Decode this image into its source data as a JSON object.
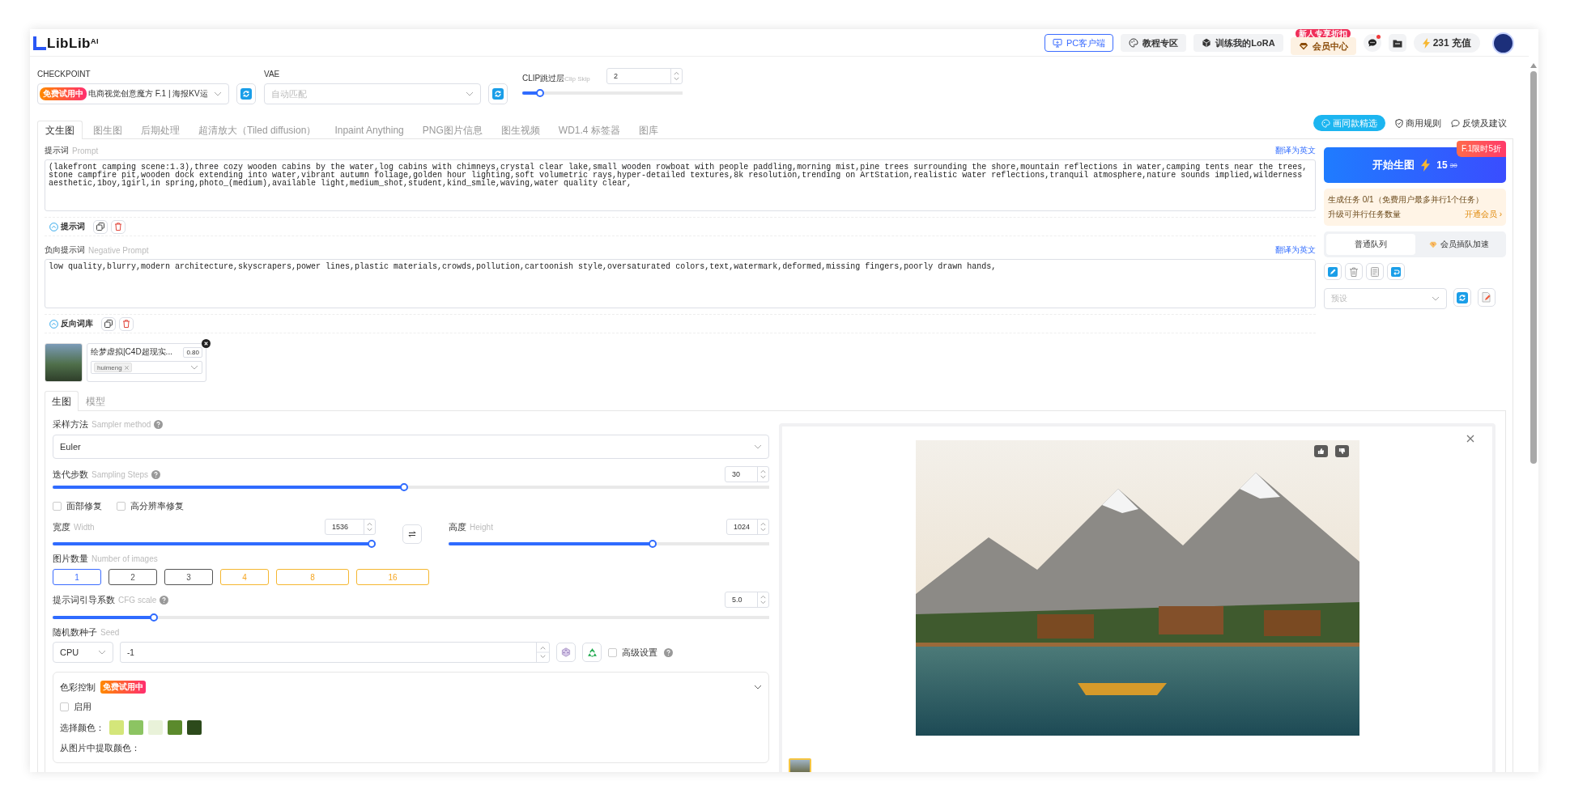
{
  "header": {
    "logo": "LibLib$^{AI}$",
    "buttons": [
      {
        "label": "PC客户端",
        "kind": "client"
      },
      {
        "label": "教程专区",
        "kind": "tutorial"
      },
      {
        "label": "训练我的LoRA",
        "kind": "training"
      },
      {
        "label": "会员中心",
        "kind": "member",
        "badge": "新人专享折扣"
      }
    ],
    "messages_unread": true,
    "credits": "231",
    "recharge": "充值"
  },
  "model": {
    "checkpoint": {
      "label": "CHECKPOINT",
      "badge": "免费试用中",
      "value": "电商视觉创意魔方 F.1 | 海报KV运"
    },
    "vae": {
      "label": "VAE",
      "placeholder": "自动匹配"
    },
    "clip_skip": {
      "label": "CLIP跳过层",
      "hint": "Clip Skip",
      "value": "2",
      "level": 0.09
    }
  },
  "tabs": [
    {
      "label": "文生图",
      "selected": true
    },
    {
      "label": "图生图",
      "selected": false
    },
    {
      "label": "后期处理",
      "selected": false
    },
    {
      "label": "超清放大（Tiled diffusion）",
      "selected": false
    },
    {
      "label": "Inpaint Anything",
      "selected": false
    },
    {
      "label": "PNG图片信息",
      "selected": false
    },
    {
      "label": "图生视频",
      "selected": false
    },
    {
      "label": "WD1.4 标签器",
      "selected": false
    },
    {
      "label": "图库",
      "selected": false
    }
  ],
  "links": [
    {
      "label": "画同款精选",
      "kind": "pill"
    },
    {
      "label": "商用规则",
      "kind": "shield"
    },
    {
      "label": "反馈及建议",
      "kind": "chat"
    }
  ],
  "prompt": {
    "label": "提示词",
    "hint": "Prompt",
    "translate": "翻译为英文",
    "value": "(lakefront camping scene:1.3),three cozy wooden cabins by the water,log cabins with chimneys,crystal clear lake,small wooden rowboat with people paddling,morning mist,pine trees surrounding the shore,mountain reflections in water,camping tents near the trees,stone campfire pit,wooden dock extending into water,vibrant autumn foliage,golden hour lighting,soft volumetric rays,hyper-detailed textures,8k resolution,trending on ArtStation,realistic water reflections,tranquil atmosphere,nature sounds implied,wilderness aesthetic,1boy,1girl,in spring,photo_(medium),available light,medium_shot,student,kind_smile,waving,water quality clear,",
    "library": "提示词"
  },
  "negative_prompt": {
    "label": "负向提示词",
    "hint": "Negative Prompt",
    "translate": "翻译为英文",
    "value": "low quality,blurry,modern architecture,skyscrapers,power lines,plastic materials,crowds,pollution,cartoonish style,oversaturated colors,text,watermark,deformed,missing fingers,poorly drawn hands,",
    "library": "反向词库"
  },
  "lora": [
    {
      "name": "绘梦虚拟|C4D超现实...",
      "weight": "0.80",
      "tags": [
        "huimeng"
      ]
    }
  ],
  "generate": {
    "label": "开始生图",
    "cost": "15",
    "original_cost": "30",
    "promo": "F.1限时5折"
  },
  "task_info": {
    "status": "生成任务 0/1（免费用户最多并行1个任务）",
    "upgrade": "升级可并行任务数量",
    "action": "开通会员 ›"
  },
  "queues": [
    {
      "label": "普通队列",
      "selected": true
    },
    {
      "label": "会员插队加速",
      "selected": false
    }
  ],
  "preset": {
    "placeholder": "预设"
  },
  "sub_tabs": [
    {
      "label": "生图",
      "selected": true
    },
    {
      "label": "模型",
      "selected": false
    }
  ],
  "params": {
    "sampler": {
      "label": "采样方法",
      "hint": "Sampler method",
      "value": "Euler"
    },
    "steps": {
      "label": "迭代步数",
      "hint": "Sampling Steps",
      "value": "30",
      "level": 0.49
    },
    "options": [
      {
        "label": "面部修复",
        "checked": false
      },
      {
        "label": "高分辨率修复",
        "checked": false
      }
    ],
    "width": {
      "label": "宽度",
      "hint": "Width",
      "value": "1536",
      "level": 1.0
    },
    "height": {
      "label": "高度",
      "hint": "Height",
      "value": "1024",
      "level": 0.64
    },
    "image_count": {
      "label": "图片数量",
      "hint": "Number of images",
      "options": [
        {
          "label": "1",
          "selected": true,
          "kind": "free"
        },
        {
          "label": "2",
          "selected": false,
          "kind": "free"
        },
        {
          "label": "3",
          "selected": false,
          "kind": "free"
        },
        {
          "label": "4",
          "selected": false,
          "kind": "premium"
        },
        {
          "label": "8",
          "selected": false,
          "kind": "premium"
        },
        {
          "label": "16",
          "selected": false,
          "kind": "premium"
        }
      ]
    },
    "cfg": {
      "label": "提示词引导系数",
      "hint": "CFG scale",
      "value": "5.0",
      "level": 0.137
    },
    "seed": {
      "label": "随机数种子",
      "hint": "Seed",
      "device": "CPU",
      "value": "-1",
      "advanced": {
        "label": "高级设置",
        "checked": false
      }
    }
  },
  "color_control": {
    "title": "色彩控制",
    "badge": "免费试用中",
    "expanded": true,
    "enable": {
      "label": "启用",
      "checked": false
    },
    "pick_label": "选择颜色：",
    "swatches": [
      {
        "color": "#d4e67a"
      },
      {
        "color": "#8cc462"
      },
      {
        "color": "#e9f2d9"
      },
      {
        "color": "#5b8a2c"
      },
      {
        "color": "#2c4a1b"
      }
    ],
    "extract_label": "从图片中提取颜色："
  }
}
